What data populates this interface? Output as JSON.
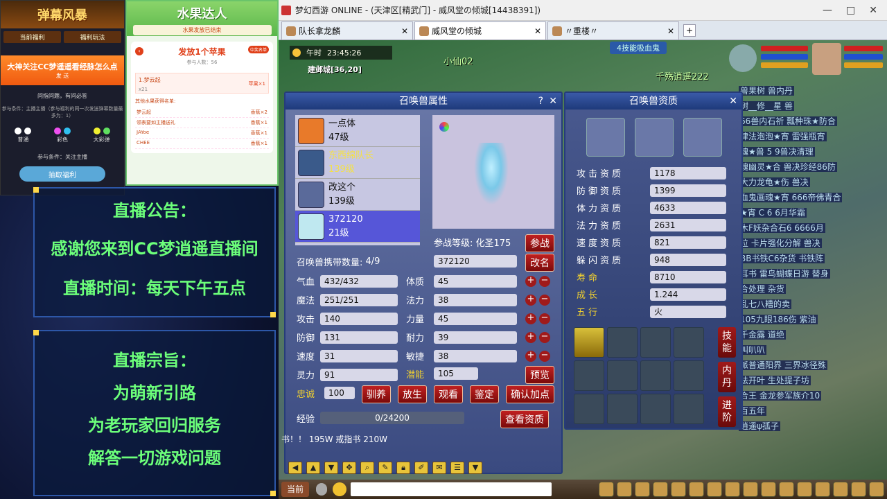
{
  "stream": {
    "promo_banner": "弹幕风暴",
    "promo_tabs": [
      "当前福利",
      "福利玩法"
    ],
    "promo_question": "大神关注CC梦遥遥看经脉怎么点",
    "promo_question_sub": "发 送",
    "promo_sub": "问指问题，有问必答",
    "promo_sub2": "参与条件：主播主播（参与福利的同一次发送弹幕数量最多为：1）",
    "tiers": [
      {
        "label": "普通",
        "colors": [
          "#ffffff",
          "#ffffff"
        ]
      },
      {
        "label": "彩色",
        "colors": [
          "#f050f0",
          "#30c0f0"
        ]
      },
      {
        "label": "大彩弹",
        "colors": [
          "#f0f030",
          "#60e060"
        ]
      }
    ],
    "promo_cond": "参与条件：关注主播",
    "promo_button": "抽取福利",
    "fruit_title": "水果达人",
    "fruit_ended": "水果发放已结束",
    "fruit_card_title": "发放1个苹果",
    "fruit_card_sub": "参与人数：56",
    "fruit_badge": "中奖名单",
    "fruit_winner_name": "1.梦云起",
    "fruit_winner_count": "x21",
    "fruit_winner_reward": "苹果×1",
    "fruit_list_header": "其他水果获得名单:",
    "fruit_list": [
      {
        "name": "梦云起",
        "reward": "香蕉×2"
      },
      {
        "name": "领表要如主播送礼",
        "reward": "香蕉×1"
      },
      {
        "name": "JAYoe",
        "reward": "香蕉×1"
      },
      {
        "name": "CHEE",
        "reward": "香蕉×1"
      }
    ],
    "notice_title": "直播公告：",
    "notice_line1": "感谢您来到CC梦逍遥直播间",
    "notice_line2": "直播时间：每天下午五点",
    "purpose_title": "直播宗旨：",
    "purpose_line1": "为萌新引路",
    "purpose_line2": "为老玩家回归服务",
    "purpose_line3": "解答一切游戏问题"
  },
  "window": {
    "title": "梦幻西游 ONLINE - (天津区[精武门] - 威风堂の倾城[14438391])",
    "tabs": [
      {
        "label": "队长拿龙麟"
      },
      {
        "label": "威风堂の倾城"
      },
      {
        "label": "〃重楼〃"
      }
    ]
  },
  "game": {
    "time_label": "午时",
    "time": "23:45:26",
    "location": "建邺城[36,20]",
    "skill_hint": "4技能吸血鬼",
    "npcs": [
      "小仙02",
      "千殇逍遥222"
    ],
    "chat": [
      "兽果树    兽内丹",
      "树__修__星    兽",
      "66兽内石祈    瓢种珠★防合",
      "律法泡泡★宵    雷强瓶宵",
      "魂★兽    5 9兽决清理",
      "魂幽灵★合    兽决珍经86防",
      "大力龙龟★伤    兽决",
      "血鬼画魂★宵    666帝佛青合",
      "★宵    C 6 6月华霜",
      "木F妖杂合石6    6666月",
      "位    卡片强化分解    兽决",
      "BB书铁C6杂货    书铁阵",
      "耳书    雷鸟蝴蝶日游    替身",
      "合处理    杂货",
      "    乱七八糟的卖",
      "105九眼186伤    紫油",
      "千金露    道绝",
      "    叫叭叭",
      "派普通阳界    三界冰径殊",
      "法开叶    生处提子坊",
      "合王    金龙参军族介10",
      "百五年",
      "逍遥ψ孤子"
    ],
    "bottom_text": "书！！ 195W   戒指书 210W",
    "current_button": "当前"
  },
  "attr_panel": {
    "title": "召唤兽属性",
    "pets": [
      {
        "name": "一点体",
        "level": "47级",
        "color": "#e87a2a",
        "style": "normal"
      },
      {
        "name": "东西绵队长",
        "level": "139级",
        "color": "#3a5a8a",
        "style": "gold"
      },
      {
        "name": "改这个",
        "level": "139级",
        "color": "#5a6a9a",
        "style": "normal"
      },
      {
        "name": "372120",
        "level": "21级",
        "color": "#bfe8f0",
        "style": "selected"
      }
    ],
    "battle_level_label": "参战等级: 化圣175",
    "battle_button": "参战",
    "carry_label": "召唤兽携带数量:",
    "carry_value": "4/9",
    "name_value": "372120",
    "rename_button": "改名",
    "stats": [
      {
        "k": "气血",
        "v": "432/432"
      },
      {
        "k": "魔法",
        "v": "251/251"
      },
      {
        "k": "攻击",
        "v": "140"
      },
      {
        "k": "防御",
        "v": "131"
      },
      {
        "k": "速度",
        "v": "31"
      },
      {
        "k": "灵力",
        "v": "91"
      }
    ],
    "points": [
      {
        "k": "体质",
        "v": "45"
      },
      {
        "k": "法力",
        "v": "38"
      },
      {
        "k": "力量",
        "v": "45"
      },
      {
        "k": "耐力",
        "v": "39"
      },
      {
        "k": "敏捷",
        "v": "38"
      }
    ],
    "potential_label": "潜能",
    "potential_value": "105",
    "preview_button": "预览",
    "loyalty_label": "忠诚",
    "loyalty_value": "100",
    "actions": [
      "驯养",
      "放生",
      "观看",
      "鉴定",
      "确认加点"
    ],
    "exp_label": "经验",
    "exp_value": "0/24200",
    "exp_fraction": 0,
    "view_apt_button": "查看资质"
  },
  "apt_panel": {
    "title": "召唤兽资质",
    "rows": [
      {
        "k": "攻击资质",
        "v": "1178",
        "gold": false
      },
      {
        "k": "防御资质",
        "v": "1399",
        "gold": false
      },
      {
        "k": "体力资质",
        "v": "4633",
        "gold": false
      },
      {
        "k": "法力资质",
        "v": "2631",
        "gold": false
      },
      {
        "k": "速度资质",
        "v": "821",
        "gold": false
      },
      {
        "k": "躲闪资质",
        "v": "948",
        "gold": false
      },
      {
        "k": "寿命",
        "v": "8710",
        "gold": true
      },
      {
        "k": "成长",
        "v": "1.244",
        "gold": true
      },
      {
        "k": "五行",
        "v": "火",
        "gold": true
      }
    ],
    "side_buttons": [
      "技能",
      "内丹",
      "进阶"
    ]
  }
}
